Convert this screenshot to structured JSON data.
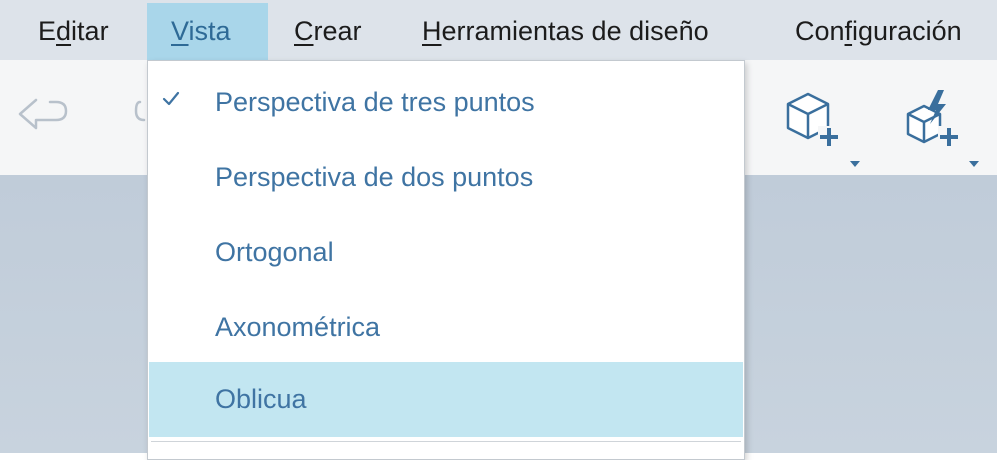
{
  "menubar": {
    "items": [
      {
        "label_pre": "E",
        "label_u": "d",
        "label_post": "itar"
      },
      {
        "label_pre": "",
        "label_u": "V",
        "label_post": "ista"
      },
      {
        "label_pre": "",
        "label_u": "C",
        "label_post": "rear"
      },
      {
        "label_pre": "",
        "label_u": "H",
        "label_post": "erramientas de diseño"
      },
      {
        "label_pre": "Con",
        "label_u": "f",
        "label_post": "iguración"
      }
    ],
    "active_index": 1
  },
  "toolbar": {
    "icons": [
      "undo-icon",
      "redo-icon",
      "cube-add-icon",
      "smart-cube-add-icon"
    ]
  },
  "view_menu": {
    "items": [
      {
        "label": "Perspectiva de tres puntos",
        "checked": true
      },
      {
        "label": "Perspectiva de dos puntos",
        "checked": false
      },
      {
        "label": "Ortogonal",
        "checked": false
      },
      {
        "label": "Axonométrica",
        "checked": false
      },
      {
        "label": "Oblicua",
        "checked": false,
        "highlighted": true
      }
    ]
  },
  "colors": {
    "menubar_bg": "#dde3ea",
    "menubar_active": "#a9d6ea",
    "menu_text": "#3f74a3",
    "highlight": "#c2e6f1",
    "icon_blue": "#3a6f9d"
  }
}
